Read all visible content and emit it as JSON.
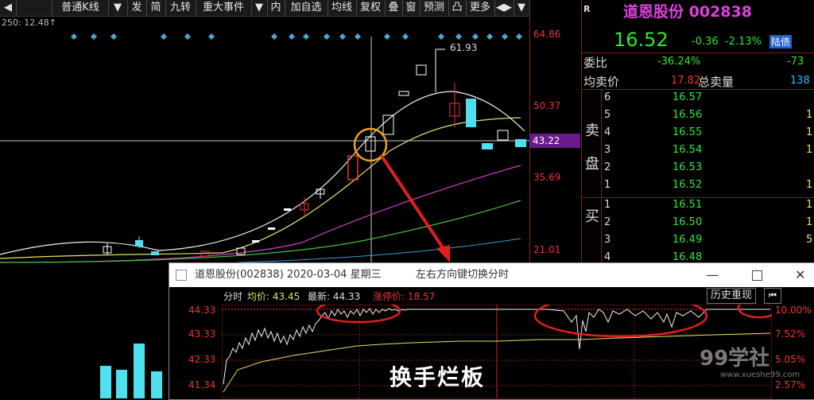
{
  "toolbar": {
    "items": [
      "普通K线",
      "▼",
      "发",
      "简",
      "九转",
      "重大事件",
      "▼",
      "内",
      "加自选",
      "均线",
      "复权",
      "叠",
      "窗",
      "预测",
      "凸",
      "更多",
      "◀▶",
      "▼"
    ]
  },
  "ma_label": "250: 12.48↑",
  "price_axis": [
    "64.86",
    "50.37",
    "35.69",
    "21.01"
  ],
  "current_price_label": "43.22",
  "high_label": "61.93",
  "stock": {
    "r_mark": "R",
    "name_code": "道恩股份 002838",
    "price": "16.52",
    "change": "-0.36",
    "pct": "-2.13%",
    "tag": "陆债",
    "weibi_label": "委比",
    "weibi_value": "-36.24%",
    "weicha_value": "-73",
    "avg_sell_label": "均卖价",
    "avg_sell_value": "17.82",
    "total_sell_label": "总卖量",
    "total_sell_value": "138",
    "sell_side_label": [
      "卖",
      "盘"
    ],
    "buy_side_label": [
      "买"
    ],
    "sell_rows": [
      {
        "n": "6",
        "p": "16.57",
        "v": ""
      },
      {
        "n": "5",
        "p": "16.56",
        "v": "1"
      },
      {
        "n": "4",
        "p": "16.55",
        "v": "1"
      },
      {
        "n": "3",
        "p": "16.54",
        "v": "1"
      },
      {
        "n": "2",
        "p": "16.53",
        "v": ""
      },
      {
        "n": "1",
        "p": "16.52",
        "v": "1"
      }
    ],
    "buy_rows": [
      {
        "n": "1",
        "p": "16.51",
        "v": "1"
      },
      {
        "n": "2",
        "p": "16.50",
        "v": "1"
      },
      {
        "n": "3",
        "p": "16.49",
        "v": "5"
      },
      {
        "n": "4",
        "p": "16.48",
        "v": ""
      }
    ]
  },
  "popup": {
    "title": "道恩股份(002838)  2020-03-04  星期三",
    "hint": "左右方向键切换分时",
    "label_fs": "分时",
    "label_avg": "均价: 43.45",
    "label_latest": "最新: 44.33",
    "label_limit": "涨停价: 18.57",
    "history_btn": "历史重现",
    "left_axis": [
      "44.33",
      "43.33",
      "42.33",
      "41.34"
    ],
    "right_axis": [
      "10.00%",
      "7.52%",
      "5.05%",
      "2.57%"
    ]
  },
  "annotation": "换手烂板",
  "watermark": "99学社",
  "watermark_url": "www.xueshe99.com"
}
